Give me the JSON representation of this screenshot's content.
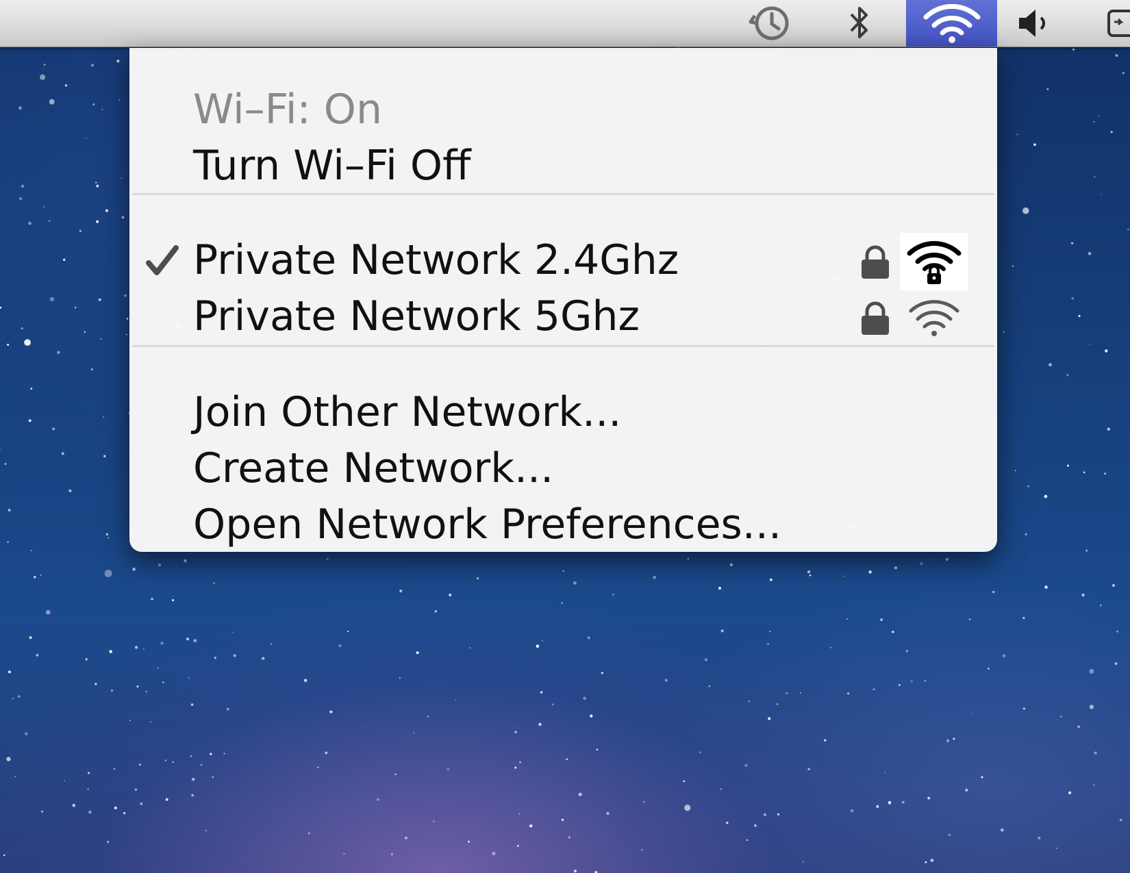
{
  "menubar": {
    "status_icons": [
      "time-machine-icon",
      "bluetooth-icon",
      "wifi-icon",
      "volume-icon",
      "battery-icon"
    ],
    "active_highlight_color": "#4f5fcc"
  },
  "wifi_menu": {
    "status_label": "Wi–Fi: On",
    "toggle_label": "Turn Wi–Fi Off",
    "networks": [
      {
        "name": "Private Network 2.4Ghz",
        "selected": true,
        "secured": true
      },
      {
        "name": "Private Network 5Ghz",
        "selected": false,
        "secured": true
      }
    ],
    "join_other_label": "Join Other Network...",
    "create_label": "Create Network...",
    "preferences_label": "Open Network Preferences..."
  }
}
